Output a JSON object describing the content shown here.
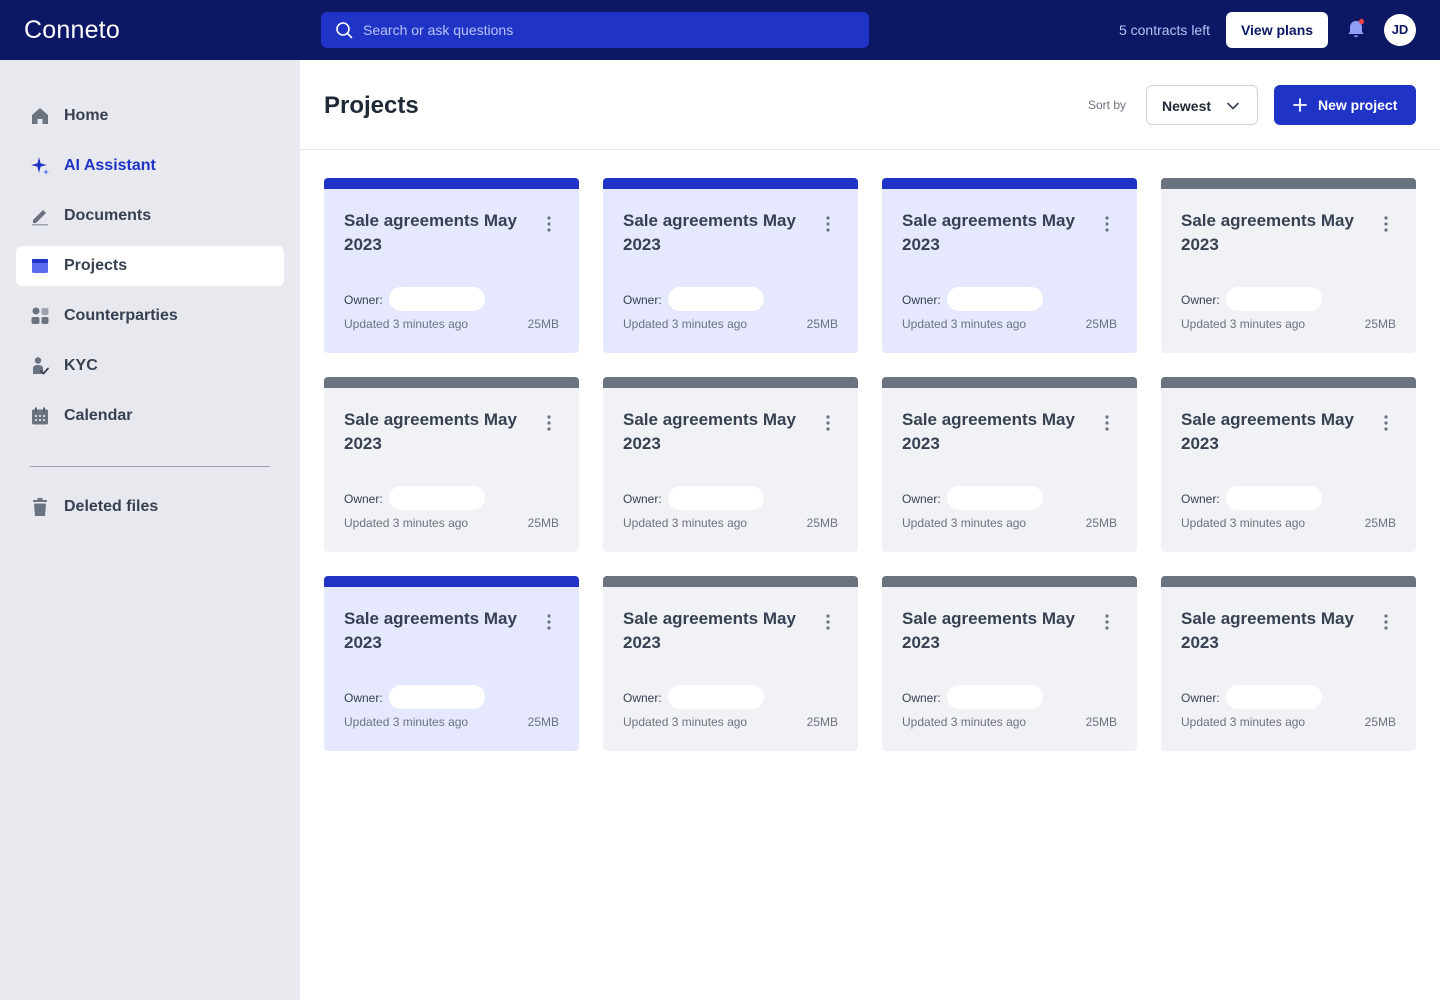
{
  "app": {
    "logo": "Conneto"
  },
  "topbar": {
    "search_placeholder": "Search or ask questions",
    "contracts_left": "5 contracts left",
    "view_plans": "View plans",
    "avatar_initials": "JD"
  },
  "sidebar": {
    "items": [
      {
        "label": "Home",
        "icon": "home-icon"
      },
      {
        "label": "AI Assistant",
        "icon": "sparkle-icon"
      },
      {
        "label": "Documents",
        "icon": "pen-icon"
      },
      {
        "label": "Projects",
        "icon": "folder-icon"
      },
      {
        "label": "Counterparties",
        "icon": "people-icon"
      },
      {
        "label": "KYC",
        "icon": "user-check-icon"
      },
      {
        "label": "Calendar",
        "icon": "calendar-icon"
      }
    ],
    "deleted": {
      "label": "Deleted files",
      "icon": "trash-icon"
    }
  },
  "main": {
    "title": "Projects",
    "sort_label": "Sort by",
    "sort_value": "Newest",
    "new_project": "New project"
  },
  "colors": {
    "navy": "#0c1766",
    "primary": "#1f34c7",
    "card_blue": "#e6e9fd",
    "card_gray": "#f1f2f6",
    "stripe_gray": "#6b7280"
  },
  "cards": [
    {
      "title": "Sale agreements May 2023",
      "owner_label": "Owner:",
      "updated": "Updated 3 minutes ago",
      "size": "25MB",
      "variant": "blue"
    },
    {
      "title": "Sale agreements May 2023",
      "owner_label": "Owner:",
      "updated": "Updated 3 minutes ago",
      "size": "25MB",
      "variant": "blue"
    },
    {
      "title": "Sale agreements May 2023",
      "owner_label": "Owner:",
      "updated": "Updated 3 minutes ago",
      "size": "25MB",
      "variant": "blue"
    },
    {
      "title": "Sale agreements May 2023",
      "owner_label": "Owner:",
      "updated": "Updated 3 minutes ago",
      "size": "25MB",
      "variant": "gray"
    },
    {
      "title": "Sale agreements May 2023",
      "owner_label": "Owner:",
      "updated": "Updated 3 minutes ago",
      "size": "25MB",
      "variant": "gray"
    },
    {
      "title": "Sale agreements May 2023",
      "owner_label": "Owner:",
      "updated": "Updated 3 minutes ago",
      "size": "25MB",
      "variant": "gray"
    },
    {
      "title": "Sale agreements May 2023",
      "owner_label": "Owner:",
      "updated": "Updated 3 minutes ago",
      "size": "25MB",
      "variant": "gray"
    },
    {
      "title": "Sale agreements May 2023",
      "owner_label": "Owner:",
      "updated": "Updated 3 minutes ago",
      "size": "25MB",
      "variant": "gray"
    },
    {
      "title": "Sale agreements May 2023",
      "owner_label": "Owner:",
      "updated": "Updated 3 minutes ago",
      "size": "25MB",
      "variant": "blue"
    },
    {
      "title": "Sale agreements May 2023",
      "owner_label": "Owner:",
      "updated": "Updated 3 minutes ago",
      "size": "25MB",
      "variant": "gray"
    },
    {
      "title": "Sale agreements May 2023",
      "owner_label": "Owner:",
      "updated": "Updated 3 minutes ago",
      "size": "25MB",
      "variant": "gray"
    },
    {
      "title": "Sale agreements May 2023",
      "owner_label": "Owner:",
      "updated": "Updated 3 minutes ago",
      "size": "25MB",
      "variant": "gray"
    }
  ]
}
